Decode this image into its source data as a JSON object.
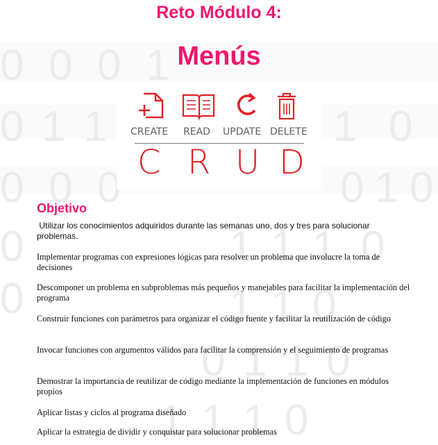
{
  "header": {
    "title": "Reto Módulo 4:",
    "subtitle": "Menús"
  },
  "crud_graphic": {
    "labels": [
      "CREATE",
      "READ",
      "UPDATE",
      "DELETE"
    ],
    "letters": [
      "C",
      "R",
      "U",
      "D"
    ],
    "icons": [
      "file-add-icon",
      "book-icon",
      "refresh-icon",
      "trash-icon"
    ],
    "accent_color": "#e02226"
  },
  "objective": {
    "heading": "Objetivo",
    "intro": "Utilizar los conocimientos adquiridos durante las semanas uno, dos y tres para solucionar problemas.",
    "items": [
      "Implementar programas con expresiones lógicas para resolver un problema que involucre la toma de decisiones",
      "Descomponer un problema en subproblemas más pequeños y manejables para facilitar la implementación del programa",
      "Construir funciones con parámetros para organizar el código fuente y facilitar la reutilización de código",
      "Invocar funciones con argumentos válidos para facilitar la comprensión y el seguimiento de programas",
      "Demostrar la importancia de reutilizar de código mediante la implementación de funciones en módulos propios",
      "Aplicar listas y ciclos al programa diseñado",
      "Aplicar la estrategia de dividir y conquistar para solucionar problemas"
    ]
  },
  "colors": {
    "heading_pink": "#f0166e",
    "background_digits": "#ececec"
  }
}
